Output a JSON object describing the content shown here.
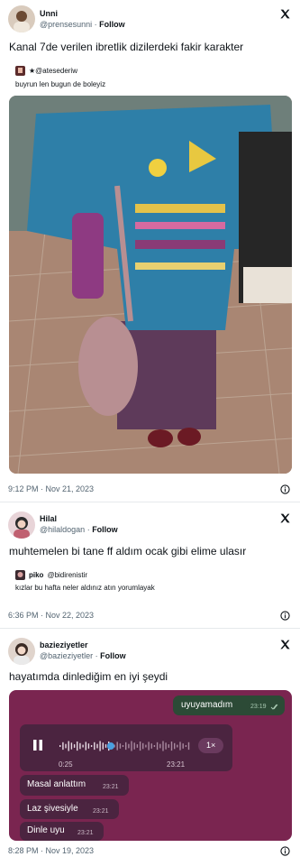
{
  "tweets": [
    {
      "name": "Unni",
      "handle": "@prensesunni",
      "follow": "Follow",
      "text": "Kanal 7de verilen ibretlik dizilerdeki fakir karakter",
      "quote": {
        "name": "★@atesederiw",
        "text": "buyrun len bugun de boleyiz"
      },
      "timestamp": "9:12 PM · Nov 21, 2023"
    },
    {
      "name": "Hilal",
      "handle": "@hilaldogan",
      "follow": "Follow",
      "text": "muhtemelen bi tane ff aldım ocak gibi elime ulasır",
      "quote": {
        "name": "piko",
        "handle": "@bidirenistir",
        "text": "kızlar bu hafta neler aldınız atın yorumlayak"
      },
      "timestamp": "6:36 PM · Nov 22, 2023"
    },
    {
      "name": "bazieziyetler",
      "handle": "@bazieziyetler",
      "follow": "Follow",
      "text": "hayatımda dinlediğim en iyi şeydi",
      "timestamp": "8:28 PM · Nov 19, 2023",
      "chat": {
        "outgoing": {
          "text": "uyuyamadım",
          "time": "23:19"
        },
        "voice": {
          "elapsed": "0:25",
          "time": "23:21",
          "speed": "1×",
          "progress": 0.39
        },
        "incoming": [
          {
            "text": "Masal anlattım",
            "time": "23:21"
          },
          {
            "text": "Laz şivesiyle",
            "time": "23:21"
          },
          {
            "text": "Dinle uyu",
            "time": "23:21"
          }
        ]
      }
    }
  ],
  "colors": {
    "handle": "#536471",
    "chat_bg": "#7a2550",
    "bubble_in": "#4b2440",
    "bubble_out": "#2c4a36",
    "accent": "#4a9fe0"
  },
  "icons": {
    "x": "x-logo-icon",
    "info": "info-icon",
    "play": "pause-icon"
  }
}
